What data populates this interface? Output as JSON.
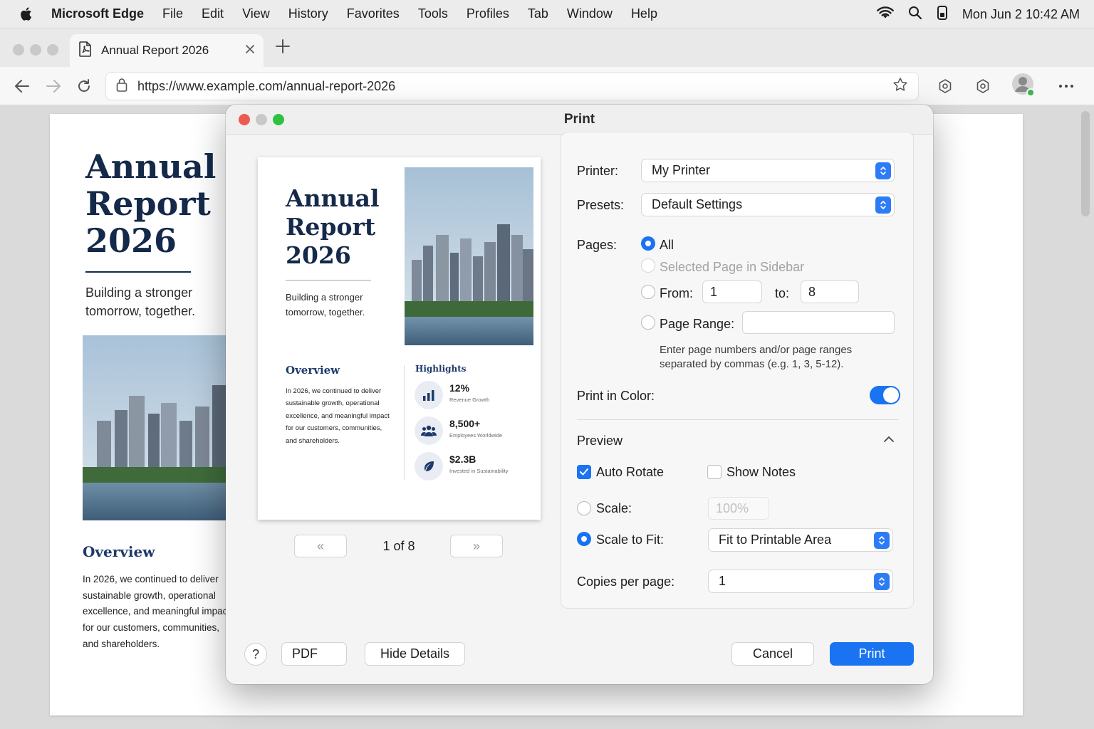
{
  "menubar": {
    "app": "Microsoft Edge",
    "items": [
      "File",
      "Edit",
      "View",
      "History",
      "Favorites",
      "Tools",
      "Profiles",
      "Tab",
      "Window",
      "Help"
    ],
    "clock": "Mon Jun 2  10:42 AM"
  },
  "tab": {
    "title": "Annual Report 2026"
  },
  "toolbar": {
    "url": "https://www.example.com/annual-report-2026"
  },
  "page": {
    "title": "Annual Report 2026",
    "subtitle": "Building a stronger tomorrow, together.",
    "overview_heading": "Overview",
    "overview_text": "In 2026, we continued to deliver sustainable growth, operational excellence, and meaningful impact for our customers, communities, and shareholders."
  },
  "dialog": {
    "title": "Print",
    "preview": {
      "title": "Annual Report 2026",
      "subtitle": "Building a stronger tomorrow, together.",
      "overview_heading": "Overview",
      "overview_text": "In 2026, we continued to deliver sustainable growth, operational excellence, and meaningful impact for our customers, communities, and shareholders.",
      "highlights_heading": "Highlights",
      "stats": [
        {
          "value": "12%",
          "label": "Revenue Growth",
          "icon": "bar-chart-icon"
        },
        {
          "value": "8,500+",
          "label": "Employees Worldwide",
          "icon": "people-icon"
        },
        {
          "value": "$2.3B",
          "label": "Invested in Sustainability",
          "icon": "leaf-icon"
        }
      ]
    },
    "pager": {
      "prev": "«",
      "next": "»",
      "status": "1 of 8"
    },
    "settings": {
      "printer_label": "Printer:",
      "printer_value": "My Printer",
      "presets_label": "Presets:",
      "presets_value": "Default Settings",
      "pages_label": "Pages:",
      "pages_all": "All",
      "pages_selected": "Selected Page in Sidebar",
      "pages_from": "From:",
      "from_value": "1",
      "pages_to": "to:",
      "to_value": "8",
      "page_range": "Page Range:",
      "page_range_value": "",
      "hint": "Enter page numbers and/or page ranges separated by commas (e.g. 1, 3, 5-12).",
      "print_color": "Print in Color:",
      "print_color_on": true,
      "preview_section": "Preview",
      "auto_rotate": "Auto Rotate",
      "auto_rotate_checked": true,
      "show_notes": "Show Notes",
      "show_notes_checked": false,
      "scale_label": "Scale:",
      "scale_placeholder": "100%",
      "scale_to_fit": "Scale to Fit:",
      "scale_to_fit_value": "Fit to Printable Area",
      "copies_label": "Copies per page:",
      "copies_value": "1"
    },
    "footer": {
      "help": "?",
      "pdf": "PDF",
      "hide_details": "Hide Details",
      "cancel": "Cancel",
      "print": "Print"
    }
  },
  "colors": {
    "accent": "#1a73f0",
    "heading": "#15294a"
  }
}
